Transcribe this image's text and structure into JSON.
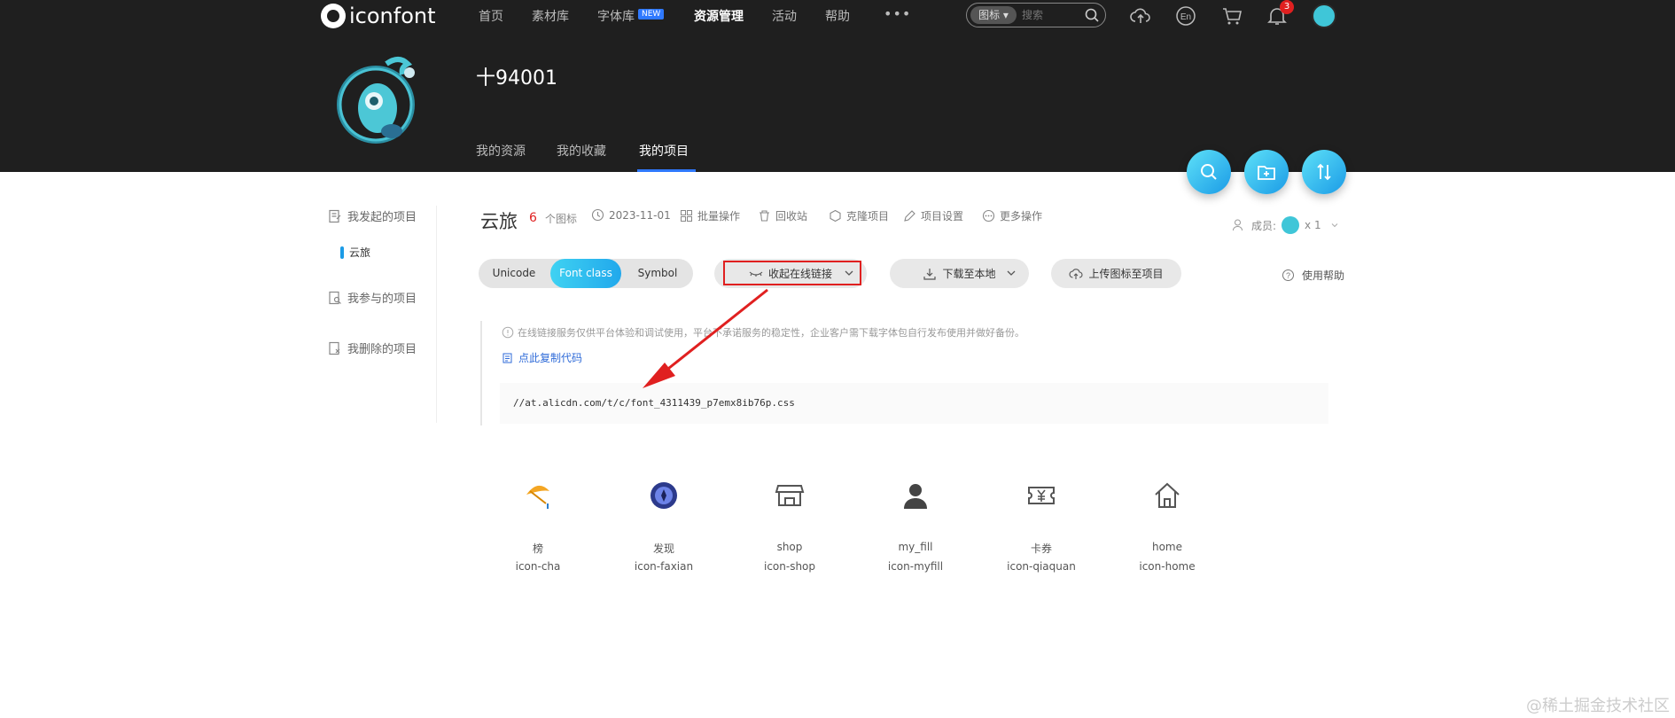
{
  "nav": {
    "logo_text": "iconfont",
    "items": [
      "首页",
      "素材库",
      "字体库",
      "资源管理",
      "活动",
      "帮助"
    ],
    "more": "•••",
    "new_badge": "NEW",
    "search_type": "图标 ▾",
    "search_placeholder": "搜索",
    "notification_count": "3"
  },
  "profile": {
    "username": "十94001",
    "tabs": [
      "我的资源",
      "我的收藏",
      "我的项目"
    ],
    "active_tab": "我的项目"
  },
  "sidebar": {
    "initiated": "我发起的项目",
    "project": "云旅",
    "participated": "我参与的项目",
    "deleted": "我删除的项目"
  },
  "project": {
    "name": "云旅",
    "icon_count": "6",
    "icon_count_label": "个图标",
    "date": "2023-11-01",
    "actions": [
      "批量操作",
      "回收站",
      "克隆项目",
      "项目设置",
      "更多操作"
    ],
    "members_label": "成员:",
    "members_count": "x 1"
  },
  "toolbar": {
    "formats": [
      "Unicode",
      "Font class",
      "Symbol"
    ],
    "active_format": "Font class",
    "collapse_link": "收起在线链接",
    "download": "下载至本地",
    "upload": "上传图标至项目",
    "help": "使用帮助"
  },
  "notice": {
    "text": "在线链接服务仅供平台体验和调试使用，平台不承诺服务的稳定性，企业客户需下载字体包自行发布使用并做好备份。",
    "copy_code": "点此复制代码",
    "code": "//at.alicdn.com/t/c/font_4311439_p7emx8ib76p.css"
  },
  "icons": [
    {
      "name": "榜",
      "class": "icon-cha",
      "icon": "kite-icon"
    },
    {
      "name": "发现",
      "class": "icon-faxian",
      "icon": "compass-icon"
    },
    {
      "name": "shop",
      "class": "icon-shop",
      "icon": "shop-icon"
    },
    {
      "name": "my_fill",
      "class": "icon-myfill",
      "icon": "user-icon"
    },
    {
      "name": "卡券",
      "class": "icon-qiaquan",
      "icon": "ticket-icon"
    },
    {
      "name": "home",
      "class": "icon-home",
      "icon": "home-icon"
    }
  ],
  "colors": {
    "accent": "#1b9be6",
    "highlight_red": "#e02020",
    "topbar": "#1f1f1f"
  },
  "watermark": "@稀土掘金技术社区"
}
